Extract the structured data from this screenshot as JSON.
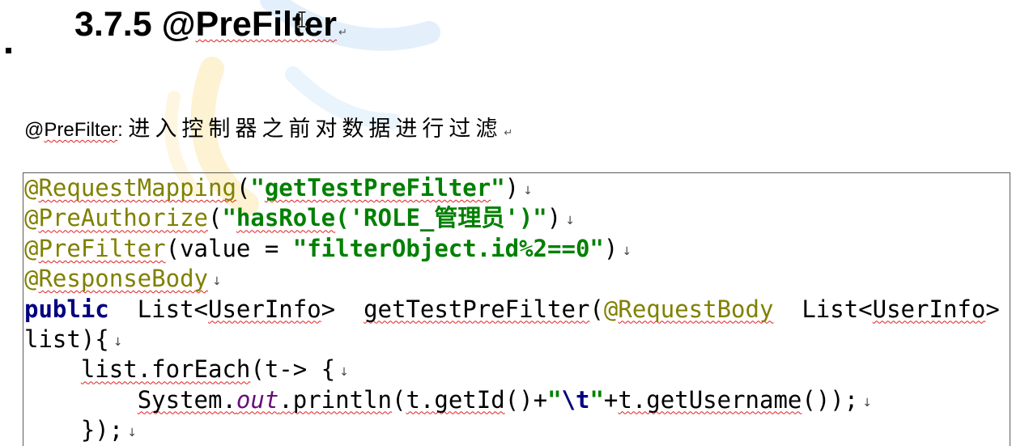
{
  "document": {
    "heading": {
      "segments": [
        {
          "text": "3.7.5 @"
        },
        {
          "text": "PreFilter",
          "spellcheck": true
        }
      ],
      "paragraph_mark": "↵"
    },
    "intro": {
      "segments": [
        {
          "text": "@"
        },
        {
          "text": "PreFilter",
          "spellcheck": true
        },
        {
          "text": ": "
        },
        {
          "text": "进入控制器之前对数据进行过滤"
        }
      ],
      "paragraph_mark": "↵"
    },
    "code_block": {
      "line_break_mark": "↓",
      "lines": [
        {
          "break_mark": true,
          "tokens": [
            {
              "annotation": "@"
            },
            {
              "annotation": "RequestMapping",
              "spellcheck": true
            },
            {
              "plain": "("
            },
            {
              "string": "\""
            },
            {
              "string": "getTestPreFilter",
              "spellcheck": true
            },
            {
              "string": "\""
            },
            {
              "plain": ")"
            }
          ]
        },
        {
          "break_mark": true,
          "tokens": [
            {
              "annotation": "@"
            },
            {
              "annotation": "PreAuthorize",
              "spellcheck": true
            },
            {
              "plain": "("
            },
            {
              "string": "\""
            },
            {
              "string": "hasRole",
              "spellcheck": true
            },
            {
              "string": "('ROLE_管理员')\""
            },
            {
              "plain": ")"
            }
          ]
        },
        {
          "break_mark": true,
          "tokens": [
            {
              "annotation": "@"
            },
            {
              "annotation": "PreFilter",
              "spellcheck": true
            },
            {
              "plain": "(value = "
            },
            {
              "string": "\"filterObject.id%2==0\""
            },
            {
              "plain": ")"
            }
          ]
        },
        {
          "break_mark": true,
          "tokens": [
            {
              "annotation": "@"
            },
            {
              "annotation": "ResponseBody",
              "spellcheck": true
            }
          ]
        },
        {
          "break_mark": false,
          "tokens": [
            {
              "keyword": "public"
            },
            {
              "plain": "  List<"
            },
            {
              "plain": "UserInfo",
              "spellcheck": true
            },
            {
              "plain": ">  "
            },
            {
              "plain": "getTestPreFilter",
              "spellcheck": true
            },
            {
              "plain": "("
            },
            {
              "annotation": "@"
            },
            {
              "annotation": "RequestBody",
              "spellcheck": true
            },
            {
              "plain": "  List<"
            },
            {
              "plain": "UserInfo",
              "spellcheck": true
            },
            {
              "plain": ">"
            }
          ]
        },
        {
          "break_mark": true,
          "tokens": [
            {
              "plain": "list){"
            }
          ]
        },
        {
          "break_mark": true,
          "tokens": [
            {
              "plain": "    "
            },
            {
              "plain": "list.forEach",
              "spellcheck": true
            },
            {
              "plain": "(t-> {"
            }
          ]
        },
        {
          "break_mark": true,
          "tokens": [
            {
              "plain": "        "
            },
            {
              "plain": "System.",
              "spellcheck": true
            },
            {
              "static_field": "out",
              "spellcheck": true
            },
            {
              "plain": ".println",
              "spellcheck": true
            },
            {
              "plain": "("
            },
            {
              "plain": "t.getId",
              "spellcheck": true
            },
            {
              "plain": "()+"
            },
            {
              "string": "\""
            },
            {
              "escape": "\\t"
            },
            {
              "string": "\""
            },
            {
              "plain": "+"
            },
            {
              "plain": "t.getUsername",
              "spellcheck": true
            },
            {
              "plain": "());"
            }
          ]
        },
        {
          "break_mark": true,
          "tokens": [
            {
              "plain": "    });"
            }
          ]
        }
      ]
    }
  },
  "syntax_colors": {
    "plain": "#000000",
    "annotation": "#808000",
    "string": "#008000",
    "keyword": "#000080",
    "static_field": "#660e7a",
    "escape": "#000080"
  },
  "spellcheck_color": "#e02020",
  "icons": {
    "text_cursor": "text-cursor-icon",
    "keep_with_next": "keep-with-next-marker",
    "watermark": "watermark-logo"
  }
}
